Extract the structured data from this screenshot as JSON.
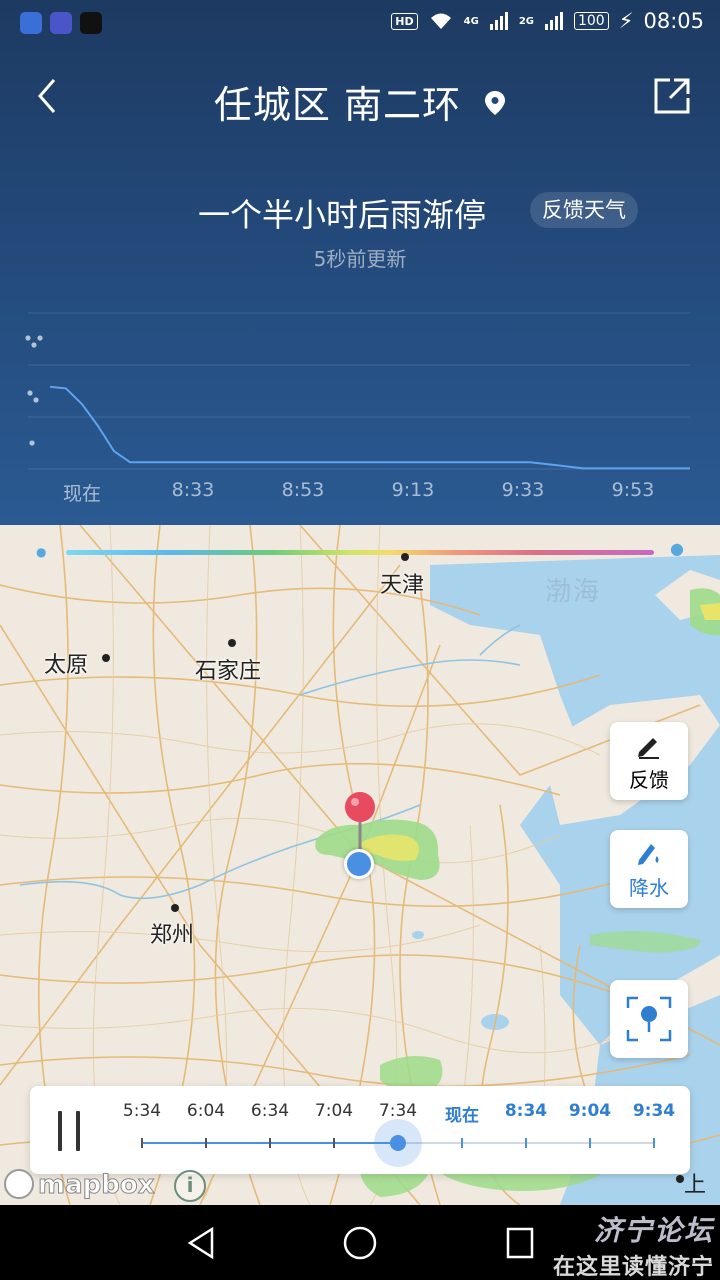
{
  "status_bar": {
    "time": "08:05",
    "battery": "100",
    "hd_badge": "HD",
    "network_1": "4G",
    "network_2": "2G"
  },
  "header": {
    "location": "任城区 南二环",
    "back_icon": "chevron-left-icon",
    "share_icon": "share-out-icon"
  },
  "forecast": {
    "headline": "一个半小时后雨渐停",
    "feedback_label": "反馈天气",
    "updated": "5秒前更新"
  },
  "chart_data": {
    "type": "line",
    "x_labels": [
      "现在",
      "8:33",
      "8:53",
      "9:13",
      "9:33",
      "9:53"
    ],
    "x_minutes": [
      0,
      120
    ],
    "points": [
      [
        0,
        0.53
      ],
      [
        3,
        0.52
      ],
      [
        6,
        0.42
      ],
      [
        9,
        0.28
      ],
      [
        12,
        0.12
      ],
      [
        15,
        0.05
      ],
      [
        20,
        0.05
      ],
      [
        30,
        0.05
      ],
      [
        40,
        0.05
      ],
      [
        50,
        0.05
      ],
      [
        60,
        0.05
      ],
      [
        70,
        0.05
      ],
      [
        80,
        0.05
      ],
      [
        90,
        0.05
      ],
      [
        95,
        0.03
      ],
      [
        100,
        0.01
      ],
      [
        110,
        0.01
      ],
      [
        120,
        0.01
      ]
    ],
    "ylim": [
      0,
      1
    ],
    "y_level_icons": [
      "heavy-rain-icon",
      "moderate-rain-icon",
      "light-rain-icon"
    ],
    "line_color": "#5ea3f0"
  },
  "map": {
    "cities": {
      "tianjin": "天津",
      "taiyuan": "太原",
      "shijiazhuang": "石家庄",
      "zhengzhou": "郑州",
      "shanghai": "上海"
    },
    "sea": "渤海",
    "feedback_button": "反馈",
    "precip_button": "降水",
    "locate_icon": "locate-icon",
    "attribution": "mapbox",
    "info_label": "i"
  },
  "timeline": {
    "labels": [
      "5:34",
      "6:04",
      "6:34",
      "7:04",
      "7:34",
      "现在",
      "8:34",
      "9:04",
      "9:34"
    ],
    "current_index": 4,
    "future_start_index": 5,
    "play_state": "paused"
  },
  "navbar": {
    "back": "nav-back-icon",
    "home": "nav-home-icon",
    "recents": "nav-recents-icon"
  },
  "watermark": {
    "line1": "济宁论坛",
    "line2": "在这里读懂济宁"
  },
  "colors": {
    "panel_top": "#1d3a61",
    "panel_bottom": "#2a5a92",
    "accent": "#4a90e2",
    "map_land": "#efe9df",
    "map_water": "#a9d2ec",
    "pin_red": "#e84a5f"
  }
}
